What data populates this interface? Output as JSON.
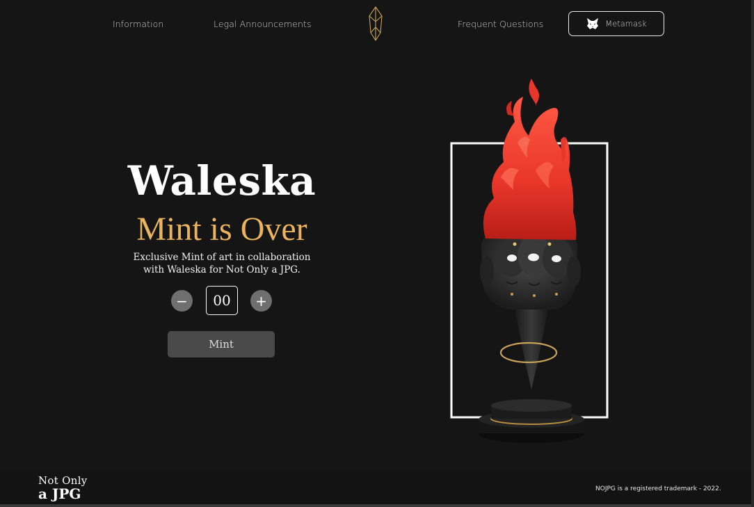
{
  "nav": {
    "information": "Information",
    "legal": "Legal Announcements",
    "faq": "Frequent Questions",
    "wallet_label": "Metamask",
    "logo_icon": "diamond-gem-icon",
    "wallet_icon": "metamask-fox-icon"
  },
  "hero": {
    "title": "Waleska",
    "subtitle": "Mint is Over",
    "description_line1": "Exclusive Mint of art in collaboration",
    "description_line2": "with Waleska for Not Only a JPG."
  },
  "mint": {
    "minus_label": "−",
    "plus_label": "+",
    "quantity": "00",
    "button_label": "Mint"
  },
  "footer": {
    "logo_line1": "Not Only",
    "logo_line2": "a JPG",
    "trademark": "NOJPG is a registered trademark - 2022."
  },
  "colors": {
    "background": "#151515",
    "accent_gold": "#e9b45b",
    "flame_red": "#e8362a",
    "button_gray": "#4a4a4a"
  }
}
